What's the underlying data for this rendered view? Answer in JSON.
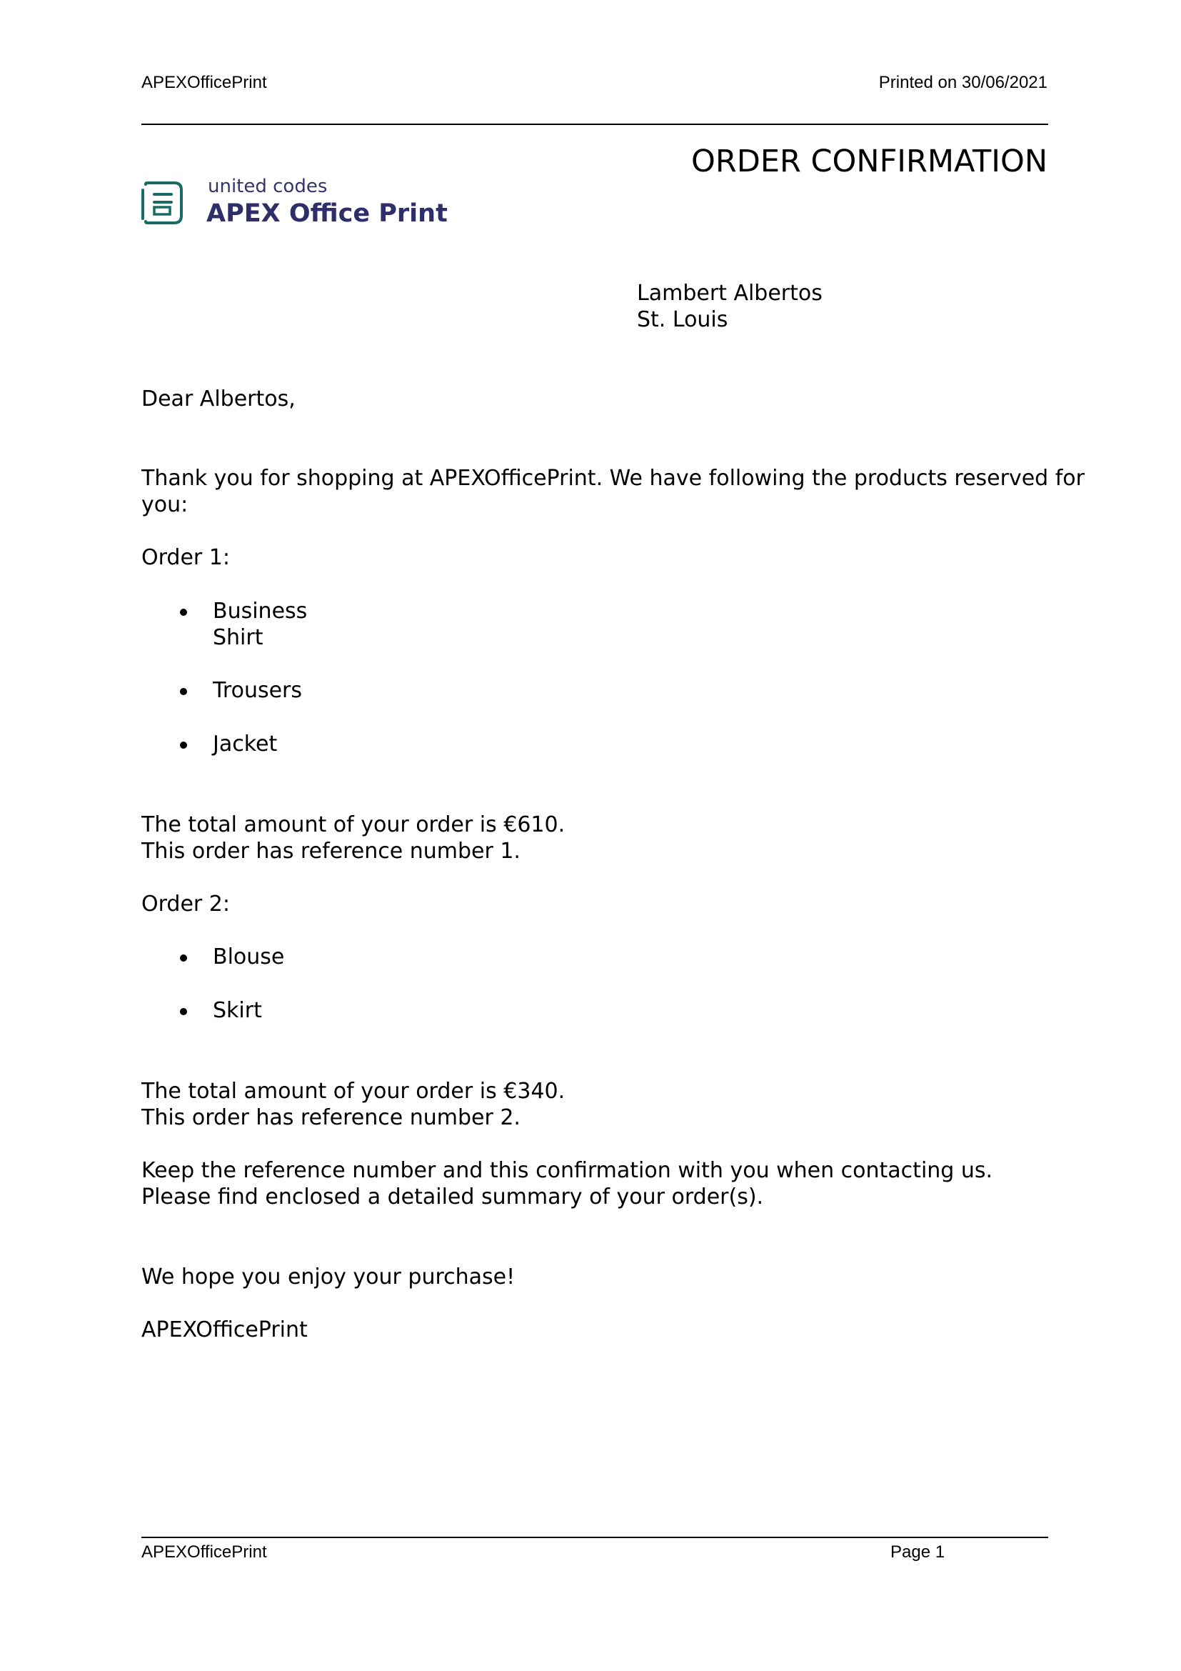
{
  "header": {
    "left": "APEXOfficePrint",
    "right": "Printed on 30/06/2021"
  },
  "title": "ORDER CONFIRMATION",
  "logo": {
    "subtitle": "united codes",
    "name": "APEX Office Print",
    "color": "#2e2f6a",
    "accent": "#1a6b63"
  },
  "address": {
    "name": "Lambert Albertos",
    "city": "St. Louis"
  },
  "letter": {
    "greeting": "Dear Albertos,",
    "intro_line1": "Thank you for shopping at APEXOfficePrint. We have following the products reserved for",
    "intro_line2": "you:",
    "orders": [
      {
        "label": "Order 1:",
        "items": [
          "Business",
          "Shirt",
          "Trousers",
          "Jacket"
        ],
        "total": "The total amount of your order is €610.",
        "reference": "This order has reference number 1."
      },
      {
        "label": "Order 2:",
        "items": [
          "Blouse",
          "Skirt"
        ],
        "total": "The total amount of your order is €340.",
        "reference": "This order has reference number 2."
      }
    ],
    "keep_line": "Keep the reference number and this confirmation with you when contacting us.",
    "enclosed_line": "Please find enclosed a detailed summary of your order(s).",
    "closing": "We hope you enjoy your purchase!",
    "signature": "APEXOfficePrint"
  },
  "footer": {
    "left": "APEXOfficePrint",
    "right": "Page 1"
  }
}
